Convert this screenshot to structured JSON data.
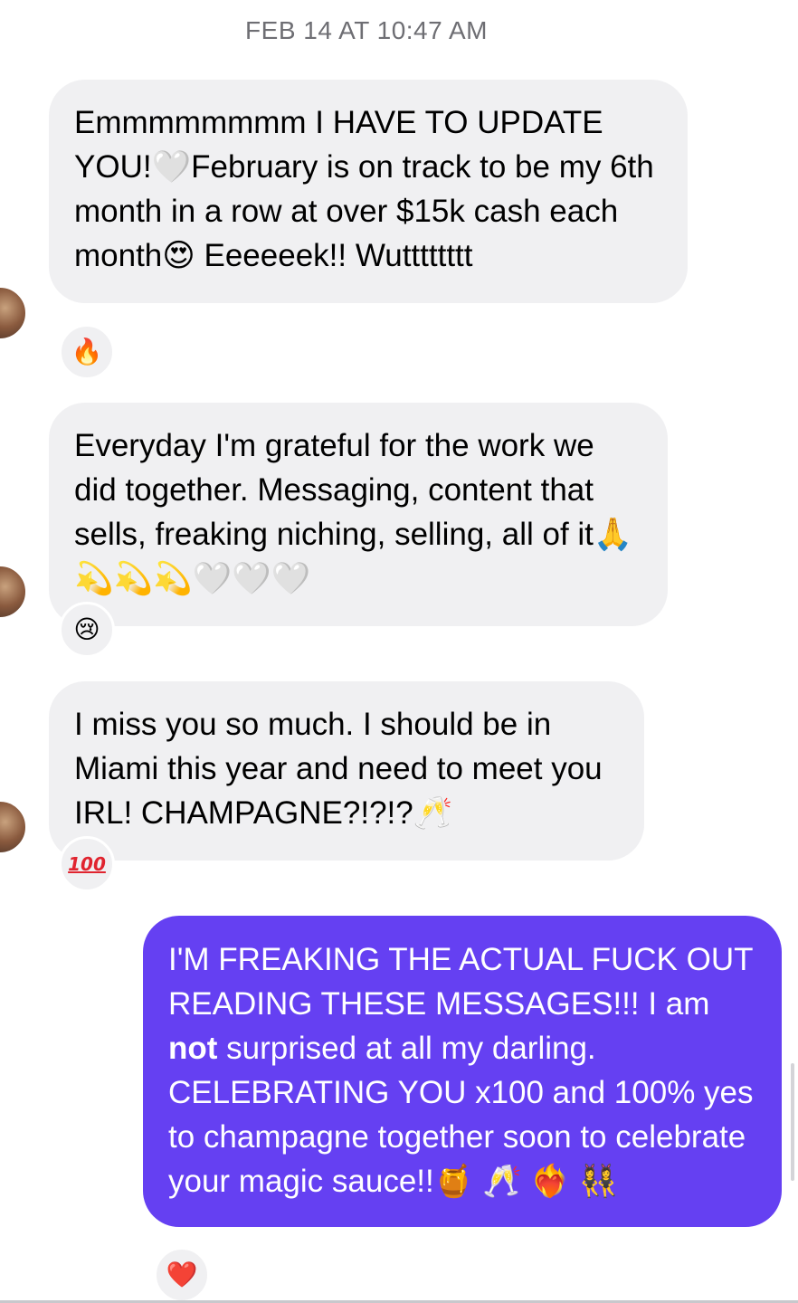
{
  "timestamp": "FEB 14 AT 10:47 AM",
  "messages": [
    {
      "direction": "incoming",
      "text": "Emmmmmmmm I HAVE TO UPDATE YOU!🤍February is on track to be my 6th month in a row at over $15k cash each month😍 Eeeeeek!! Wutttttttt",
      "reaction": "🔥"
    },
    {
      "direction": "incoming",
      "text": "Everyday I'm grateful for the work we did together. Messaging, content that sells, freaking niching, selling, all of it🙏💫💫💫🤍🤍🤍",
      "reaction": "😢"
    },
    {
      "direction": "incoming",
      "text": "I miss you so much. I should be in Miami this year and need to meet you IRL! CHAMPAGNE?!?!?🥂",
      "reaction": "100"
    },
    {
      "direction": "outgoing",
      "text_part1": "I'M FREAKING THE ACTUAL FUCK OUT READING THESE MESSAGES!!! I am ",
      "text_bold": "not",
      "text_part2": " surprised at all my darling. CELEBRATING YOU x100 and 100% yes to champagne together soon to celebrate your magic sauce!!🍯 🥂 ❤️‍🔥 👯‍♀️",
      "reaction": "❤️"
    }
  ],
  "colors": {
    "incoming_bubble": "#f0f0f2",
    "outgoing_bubble": "#6540f2",
    "timestamp": "#6e6e73"
  }
}
